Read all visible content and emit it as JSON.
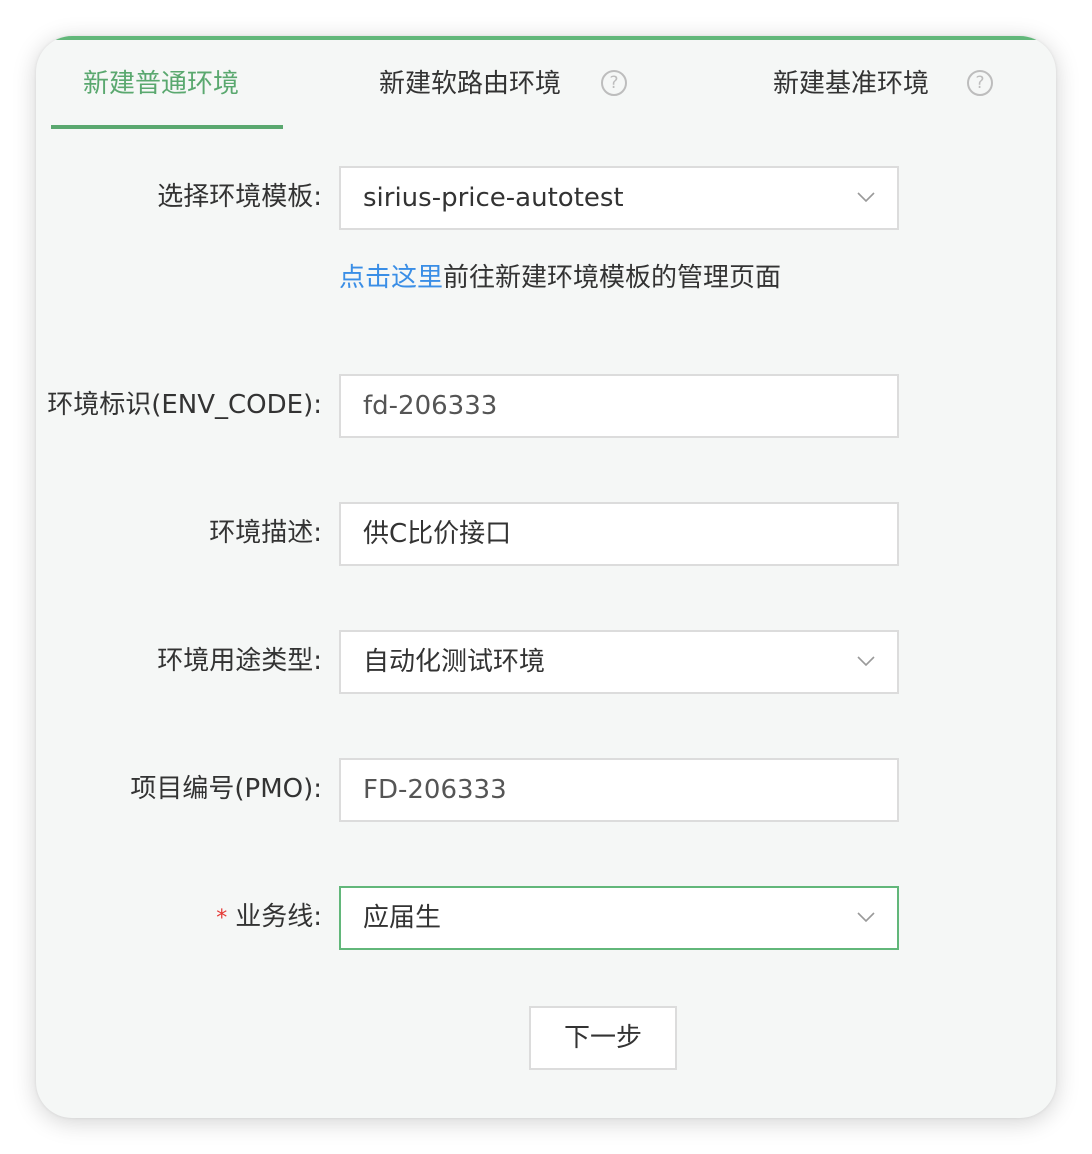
{
  "tabs": [
    {
      "label": "新建普通环境",
      "active": true,
      "help": false
    },
    {
      "label": "新建软路由环境",
      "active": false,
      "help": true
    },
    {
      "label": "新建基准环境",
      "active": false,
      "help": true
    }
  ],
  "help_icon_glyph": "?",
  "accent_color": "#5aa86f",
  "link_color": "#3a8ee6",
  "form": {
    "template": {
      "label": "选择环境模板:",
      "value": "sirius-price-autotest"
    },
    "template_hint": {
      "link_text": "点击这里",
      "rest_text": "前往新建环境模板的管理页面"
    },
    "env_code": {
      "label": "环境标识(ENV_CODE):",
      "value": "fd-206333"
    },
    "description": {
      "label": "环境描述:",
      "value": "供C比价接口"
    },
    "usage_type": {
      "label": "环境用途类型:",
      "value": "自动化测试环境"
    },
    "pmo": {
      "label": "项目编号(PMO):",
      "value": "FD-206333"
    },
    "business_line": {
      "required_mark": "*",
      "label": "业务线:",
      "value": "应届生"
    }
  },
  "next_button": {
    "label": "下一步"
  }
}
